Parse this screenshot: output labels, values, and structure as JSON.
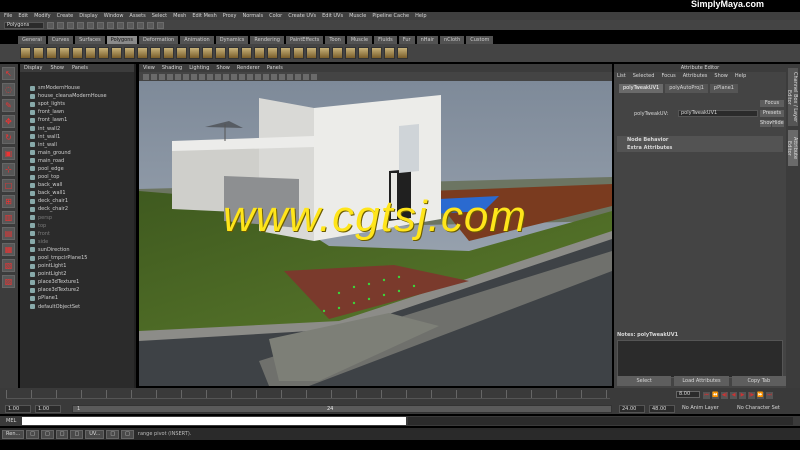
{
  "topbar": {
    "logo": "SimplyMaya.com"
  },
  "menubar": {
    "items": [
      "File",
      "Edit",
      "Modify",
      "Create",
      "Display",
      "Window",
      "Assets",
      "Select",
      "Mesh",
      "Edit Mesh",
      "Proxy",
      "Normals",
      "Color",
      "Create UVs",
      "Edit UVs",
      "Muscle",
      "Pipeline Cache",
      "Help"
    ]
  },
  "status": {
    "mode": "Polygons"
  },
  "shelf": {
    "tabs": [
      "General",
      "Curves",
      "Surfaces",
      "Polygons",
      "Deformation",
      "Animation",
      "Dynamics",
      "Rendering",
      "PaintEffects",
      "Toon",
      "Muscle",
      "Fluids",
      "Fur",
      "nHair",
      "nCloth",
      "Custom"
    ],
    "active_tab": "Polygons"
  },
  "outliner": {
    "menu": [
      "Display",
      "Show",
      "Panels"
    ],
    "items": [
      {
        "label": "smModernHouse",
        "dim": false
      },
      {
        "label": "house_cleanaModernHouse",
        "dim": false
      },
      {
        "label": "spot_lights",
        "dim": false
      },
      {
        "label": "front_lawn",
        "dim": false
      },
      {
        "label": "front_lawn1",
        "dim": false
      },
      {
        "label": "int_wall2",
        "dim": false
      },
      {
        "label": "int_wall1",
        "dim": false
      },
      {
        "label": "int_wall",
        "dim": false
      },
      {
        "label": "main_ground",
        "dim": false
      },
      {
        "label": "main_road",
        "dim": false
      },
      {
        "label": "pool_edge",
        "dim": false
      },
      {
        "label": "pool_top",
        "dim": false
      },
      {
        "label": "back_wall",
        "dim": false
      },
      {
        "label": "back_wall1",
        "dim": false
      },
      {
        "label": "deck_chair1",
        "dim": false
      },
      {
        "label": "deck_chair2",
        "dim": false
      },
      {
        "label": "persp",
        "dim": true
      },
      {
        "label": "top",
        "dim": true
      },
      {
        "label": "front",
        "dim": true
      },
      {
        "label": "side",
        "dim": true
      },
      {
        "label": "sunDirection",
        "dim": false
      },
      {
        "label": "pool_tmpcirPlane15",
        "dim": false
      },
      {
        "label": "pointLight1",
        "dim": false
      },
      {
        "label": "pointLight2",
        "dim": false
      },
      {
        "label": "place3dTexture1",
        "dim": false
      },
      {
        "label": "place3dTexture2",
        "dim": false
      },
      {
        "label": "pPlane1",
        "dim": false
      },
      {
        "label": "defaultObjectSet",
        "dim": false
      }
    ]
  },
  "viewport": {
    "menu": [
      "View",
      "Shading",
      "Lighting",
      "Show",
      "Renderer",
      "Panels"
    ],
    "watermark": "www.cgtsj.com"
  },
  "attribute_editor": {
    "title": "Attribute Editor",
    "menu": [
      "List",
      "Selected",
      "Focus",
      "Attributes",
      "Show",
      "Help"
    ],
    "tabs": [
      "polyTweakUV1",
      "polyAutoProj1",
      "pPlane1"
    ],
    "node_label": "polyTweakUV:",
    "node_value": "polyTweakUV1",
    "focus_btn": "Focus",
    "presets_btn": "Presets",
    "show_btn": "Show",
    "hide_btn": "Hide",
    "sections": [
      "Node Behavior",
      "Extra Attributes"
    ],
    "notes_label": "Notes: polyTweakUV1",
    "buttons": [
      "Select",
      "Load Attributes",
      "Copy Tab"
    ],
    "side_tabs": [
      "Channel Box / Layer Editor",
      "Attribute Editor"
    ]
  },
  "timeline": {
    "current_frame": "8.00",
    "ticks": [
      "1",
      "2",
      "3",
      "4",
      "5",
      "6",
      "7",
      "8",
      "9",
      "10",
      "11",
      "12",
      "13",
      "14",
      "15",
      "16",
      "17",
      "18",
      "19",
      "20",
      "21",
      "22",
      "23",
      "24"
    ]
  },
  "range": {
    "start": "1.00",
    "start2": "1.00",
    "slider_start": "1",
    "slider_end": "24",
    "end": "24.00",
    "end2": "48.00",
    "anim_layer": "No Anim Layer",
    "char_set": "No Character Set"
  },
  "cmdline": {
    "label": "MEL"
  },
  "taskbar": {
    "items": [
      "Ren...",
      "",
      "",
      "",
      "",
      "UV...",
      "",
      "",
      ""
    ],
    "help_text": "range pivot (INSERT)."
  }
}
